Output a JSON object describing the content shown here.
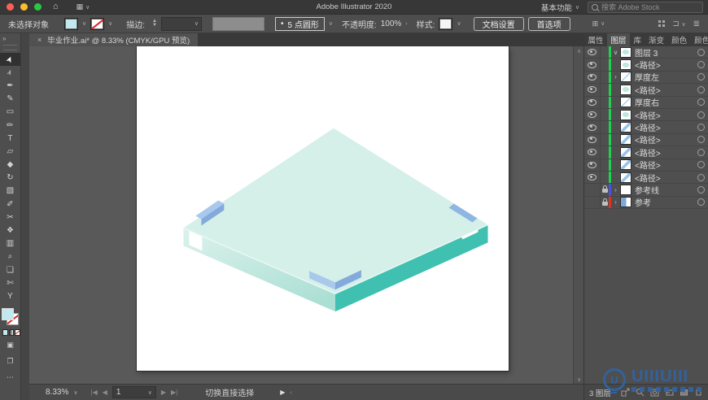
{
  "titlebar": {
    "title": "Adobe Illustrator 2020",
    "workspace": "基本功能",
    "search_placeholder": "搜索 Adobe Stock"
  },
  "controlbar": {
    "selection_status": "未选择对象",
    "stroke_label": "描边:",
    "brush_bullet": "•",
    "brush_name": "5 点圆形",
    "opacity_label": "不透明度:",
    "opacity_value": "100%",
    "style_label": "样式:",
    "document_setup": "文档设置",
    "preferences": "首选项",
    "fill_swatch_color": "#c2e8ee",
    "style_swatch_color": "#f5f5f5"
  },
  "document_tab": {
    "close": "×",
    "title": "毕业作业.ai* @ 8.33% (CMYK/GPU 预览)"
  },
  "toolbar": {
    "collapse": "»",
    "tools": [
      {
        "name": "selection-tool",
        "glyph": "➤",
        "rot": true,
        "selected": true
      },
      {
        "name": "direct-selection-tool",
        "glyph": "➢",
        "rot": true,
        "selected": false
      },
      {
        "name": "pen-tool",
        "glyph": "✒",
        "rot": false,
        "selected": false
      },
      {
        "name": "curvature-tool",
        "glyph": "✎",
        "rot": false,
        "selected": false
      },
      {
        "name": "rectangle-tool",
        "glyph": "▭",
        "rot": false,
        "selected": false
      },
      {
        "name": "paintbrush-tool",
        "glyph": "✏",
        "rot": false,
        "selected": false
      },
      {
        "name": "type-tool",
        "glyph": "T",
        "rot": false,
        "selected": false
      },
      {
        "name": "free-transform-tool",
        "glyph": "▱",
        "rot": false,
        "selected": false
      },
      {
        "name": "shaper-tool",
        "glyph": "◆",
        "rot": false,
        "selected": false
      },
      {
        "name": "rotate-tool",
        "glyph": "↻",
        "rot": false,
        "selected": false
      },
      {
        "name": "gradient-tool",
        "glyph": "▧",
        "rot": false,
        "selected": false
      },
      {
        "name": "eyedropper-tool",
        "glyph": "✐",
        "rot": false,
        "selected": false
      },
      {
        "name": "scissors-tool",
        "glyph": "✂",
        "rot": false,
        "selected": false
      },
      {
        "name": "symbol-sprayer-tool",
        "glyph": "❖",
        "rot": false,
        "selected": false
      },
      {
        "name": "graph-tool",
        "glyph": "▥",
        "rot": false,
        "selected": false
      },
      {
        "name": "zoom-tool",
        "glyph": "⌕",
        "rot": false,
        "selected": false
      },
      {
        "name": "artboard-tool",
        "glyph": "❏",
        "rot": false,
        "selected": false
      },
      {
        "name": "slice-tool",
        "glyph": "✄",
        "rot": false,
        "selected": false
      },
      {
        "name": "join-tool",
        "glyph": "Y",
        "rot": false,
        "selected": false
      }
    ],
    "ellipsis": "⋯"
  },
  "artwork": {
    "colors": {
      "top_face": "#d5efe9",
      "left_face_start": "#dbf2ec",
      "left_face_end": "#abdfd4",
      "right_face": "#3fc0b0",
      "edge_highlight": "#eaf8f4",
      "tab_light": "#a8c8ec",
      "tab_dark": "#83aadb",
      "tab_right": "#8fb6e3"
    }
  },
  "layers_panel": {
    "tabs": [
      {
        "label": "属性",
        "active": false
      },
      {
        "label": "图层",
        "active": true
      },
      {
        "label": "库",
        "active": false
      },
      {
        "label": "渐变",
        "active": false
      },
      {
        "label": "颜色",
        "active": false
      },
      {
        "label": "颜色参",
        "active": false
      }
    ],
    "menu_icon": "≡",
    "bar_colors": {
      "green": "#1ed24f",
      "blue": "#5050e0",
      "red": "#e03222"
    },
    "rows": [
      {
        "name": "图层 3",
        "bar": "green",
        "eye": true,
        "lock": false,
        "expand": "down",
        "thumb": "blob"
      },
      {
        "name": "<路径>",
        "bar": "green",
        "eye": true,
        "lock": false,
        "expand": "",
        "thumb": "blob"
      },
      {
        "name": "厚度左",
        "bar": "green",
        "eye": true,
        "lock": false,
        "expand": "right",
        "thumb": "line"
      },
      {
        "name": "<路径>",
        "bar": "green",
        "eye": true,
        "lock": false,
        "expand": "",
        "thumb": "blob"
      },
      {
        "name": "厚度右",
        "bar": "green",
        "eye": true,
        "lock": false,
        "expand": "",
        "thumb": "line"
      },
      {
        "name": "<路径>",
        "bar": "green",
        "eye": true,
        "lock": false,
        "expand": "",
        "thumb": "blob"
      },
      {
        "name": "<路径>",
        "bar": "green",
        "eye": true,
        "lock": false,
        "expand": "",
        "thumb": "diag"
      },
      {
        "name": "<路径>",
        "bar": "green",
        "eye": true,
        "lock": false,
        "expand": "",
        "thumb": "diag"
      },
      {
        "name": "<路径>",
        "bar": "green",
        "eye": true,
        "lock": false,
        "expand": "",
        "thumb": "diag"
      },
      {
        "name": "<路径>",
        "bar": "green",
        "eye": true,
        "lock": false,
        "expand": "",
        "thumb": "diag"
      },
      {
        "name": "<路径>",
        "bar": "green",
        "eye": true,
        "lock": false,
        "expand": "",
        "thumb": "diag"
      },
      {
        "name": "参考线",
        "bar": "blue",
        "eye": false,
        "lock": true,
        "expand": "right",
        "thumb": "white"
      },
      {
        "name": "参考",
        "bar": "red",
        "eye": false,
        "lock": true,
        "expand": "right",
        "thumb": "guides"
      }
    ],
    "footer": {
      "count": "3 图层"
    }
  },
  "statusbar": {
    "zoom": "8.33%",
    "artboard_number": "1",
    "hint": "切换直接选择"
  },
  "watermark": {
    "text": "UIIIUIII"
  }
}
